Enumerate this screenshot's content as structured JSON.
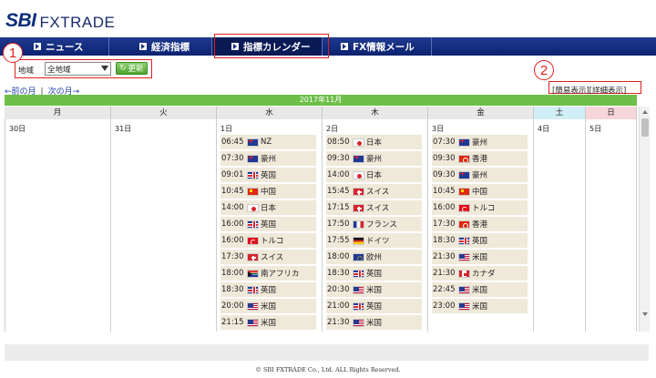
{
  "logo": {
    "brand": "SBI",
    "name": "FXTRADE"
  },
  "nav": {
    "items": [
      {
        "label": "ニュース",
        "width": 118
      },
      {
        "label": "経済指標",
        "width": 118
      },
      {
        "label": "指標カレンダー",
        "width": 121,
        "active": true
      },
      {
        "label": "FX情報メール",
        "width": 118
      }
    ]
  },
  "annotations": {
    "one": "1",
    "two": "2"
  },
  "filter": {
    "region_label": "地域",
    "region_value": "全地域",
    "update_button": "更新"
  },
  "month_nav": {
    "prev": "←前の月",
    "sep": "|",
    "next": "次の月→"
  },
  "view_links": {
    "simple": "[簡易表示]",
    "detail": "[詳細表示]"
  },
  "calendar": {
    "month": "2017年11月",
    "weekdays": [
      {
        "label": "月",
        "type": "weekday",
        "w": 117
      },
      {
        "label": "火",
        "type": "weekday",
        "w": 116
      },
      {
        "label": "水",
        "type": "weekday",
        "w": 116
      },
      {
        "label": "木",
        "type": "weekday",
        "w": 116
      },
      {
        "label": "金",
        "type": "weekday",
        "w": 116
      },
      {
        "label": "土",
        "type": "sat",
        "w": 57
      },
      {
        "label": "日",
        "type": "sun",
        "w": 56
      }
    ],
    "days": [
      {
        "date": "30日",
        "events": []
      },
      {
        "date": "31日",
        "events": []
      },
      {
        "date": "1日",
        "events": [
          {
            "time": "06:45",
            "flag": "nz",
            "country": "NZ"
          },
          {
            "time": "07:30",
            "flag": "au",
            "country": "豪州"
          },
          {
            "time": "09:01",
            "flag": "gb",
            "country": "英国"
          },
          {
            "time": "10:45",
            "flag": "cn",
            "country": "中国"
          },
          {
            "time": "14:00",
            "flag": "jp",
            "country": "日本"
          },
          {
            "time": "16:00",
            "flag": "gb",
            "country": "英国"
          },
          {
            "time": "16:00",
            "flag": "tr",
            "country": "トルコ"
          },
          {
            "time": "17:30",
            "flag": "ch",
            "country": "スイス"
          },
          {
            "time": "18:00",
            "flag": "za",
            "country": "南アフリカ"
          },
          {
            "time": "18:30",
            "flag": "gb",
            "country": "英国"
          },
          {
            "time": "20:00",
            "flag": "us",
            "country": "米国"
          },
          {
            "time": "21:15",
            "flag": "us",
            "country": "米国"
          }
        ]
      },
      {
        "date": "2日",
        "events": [
          {
            "time": "08:50",
            "flag": "jp",
            "country": "日本"
          },
          {
            "time": "09:30",
            "flag": "au",
            "country": "豪州"
          },
          {
            "time": "14:00",
            "flag": "jp",
            "country": "日本"
          },
          {
            "time": "15:45",
            "flag": "ch",
            "country": "スイス"
          },
          {
            "time": "17:15",
            "flag": "ch",
            "country": "スイス"
          },
          {
            "time": "17:50",
            "flag": "fr",
            "country": "フランス"
          },
          {
            "time": "17:55",
            "flag": "de",
            "country": "ドイツ"
          },
          {
            "time": "18:00",
            "flag": "eu",
            "country": "欧州"
          },
          {
            "time": "18:30",
            "flag": "gb",
            "country": "英国"
          },
          {
            "time": "20:30",
            "flag": "us",
            "country": "米国"
          },
          {
            "time": "21:00",
            "flag": "gb",
            "country": "英国"
          },
          {
            "time": "21:30",
            "flag": "us",
            "country": "米国"
          }
        ]
      },
      {
        "date": "3日",
        "events": [
          {
            "time": "07:30",
            "flag": "au",
            "country": "豪州"
          },
          {
            "time": "09:30",
            "flag": "hk",
            "country": "香港"
          },
          {
            "time": "09:30",
            "flag": "au",
            "country": "豪州"
          },
          {
            "time": "10:45",
            "flag": "cn",
            "country": "中国"
          },
          {
            "time": "16:00",
            "flag": "tr",
            "country": "トルコ"
          },
          {
            "time": "17:30",
            "flag": "hk",
            "country": "香港"
          },
          {
            "time": "18:30",
            "flag": "gb",
            "country": "英国"
          },
          {
            "time": "21:30",
            "flag": "us",
            "country": "米国"
          },
          {
            "time": "21:30",
            "flag": "ca",
            "country": "カナダ"
          },
          {
            "time": "22:45",
            "flag": "us",
            "country": "米国"
          },
          {
            "time": "23:00",
            "flag": "us",
            "country": "米国"
          }
        ]
      },
      {
        "date": "4日",
        "events": []
      },
      {
        "date": "5日",
        "events": []
      }
    ]
  },
  "footer": {
    "copyright": "© SBI FXTRADE Co., Ltd. ALL Rights Reserved."
  }
}
